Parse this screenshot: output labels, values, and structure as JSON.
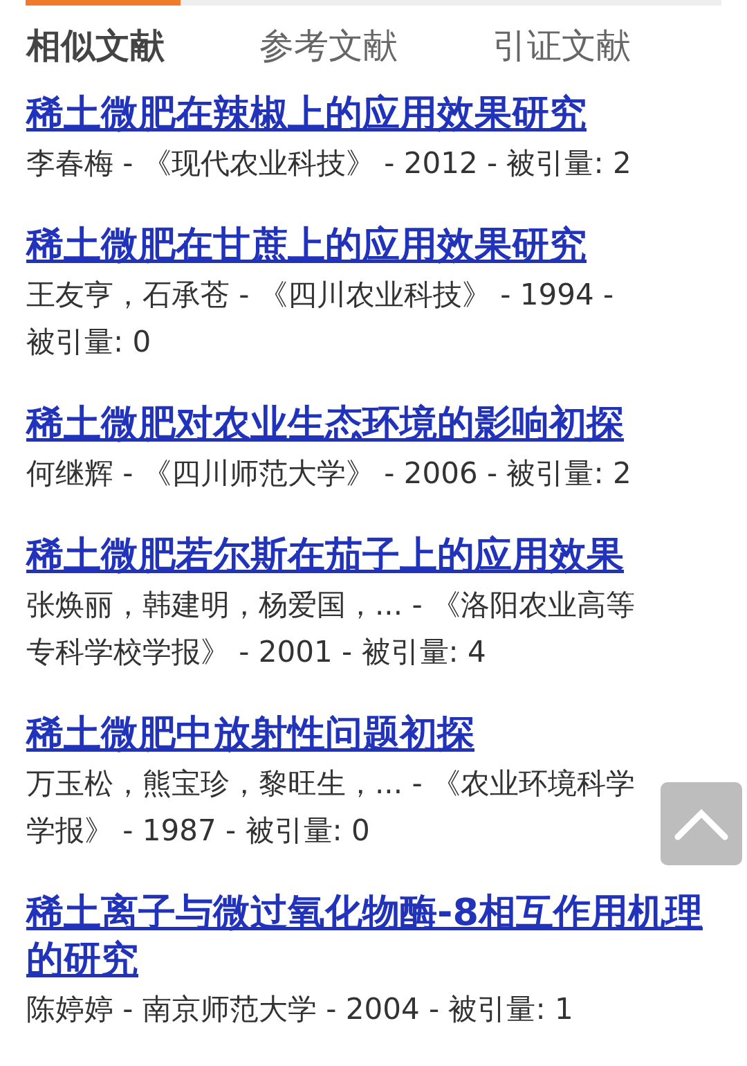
{
  "tabs": [
    {
      "label": "相似文献",
      "selected": true
    },
    {
      "label": "参考文献",
      "selected": false
    },
    {
      "label": "引证文献",
      "selected": false
    }
  ],
  "articles": [
    {
      "title": "稀土微肥在辣椒上的应用效果研究",
      "meta": "李春梅 - 《现代农业科技》 - 2012 - 被引量: 2"
    },
    {
      "title": "稀土微肥在甘蔗上的应用效果研究",
      "meta": "王友亨，石承苍 - 《四川农业科技》 - 1994 - 被引量: 0"
    },
    {
      "title": "稀土微肥对农业生态环境的影响初探",
      "meta": "何继辉 - 《四川师范大学》 - 2006 - 被引量: 2"
    },
    {
      "title": "稀土微肥若尔斯在茄子上的应用效果",
      "meta": "张焕丽，韩建明，杨爱国，... - 《洛阳农业高等专科学校学报》 - 2001 - 被引量: 4"
    },
    {
      "title": "稀土微肥中放射性问题初探",
      "meta": "万玉松，熊宝珍，黎旺生，... - 《农业环境科学学报》 - 1987 - 被引量: 0"
    },
    {
      "title": "稀土离子与微过氧化物酶-8相互作用机理的研究",
      "meta": "陈婷婷 - 南京师范大学 - 2004 - 被引量: 1"
    }
  ]
}
